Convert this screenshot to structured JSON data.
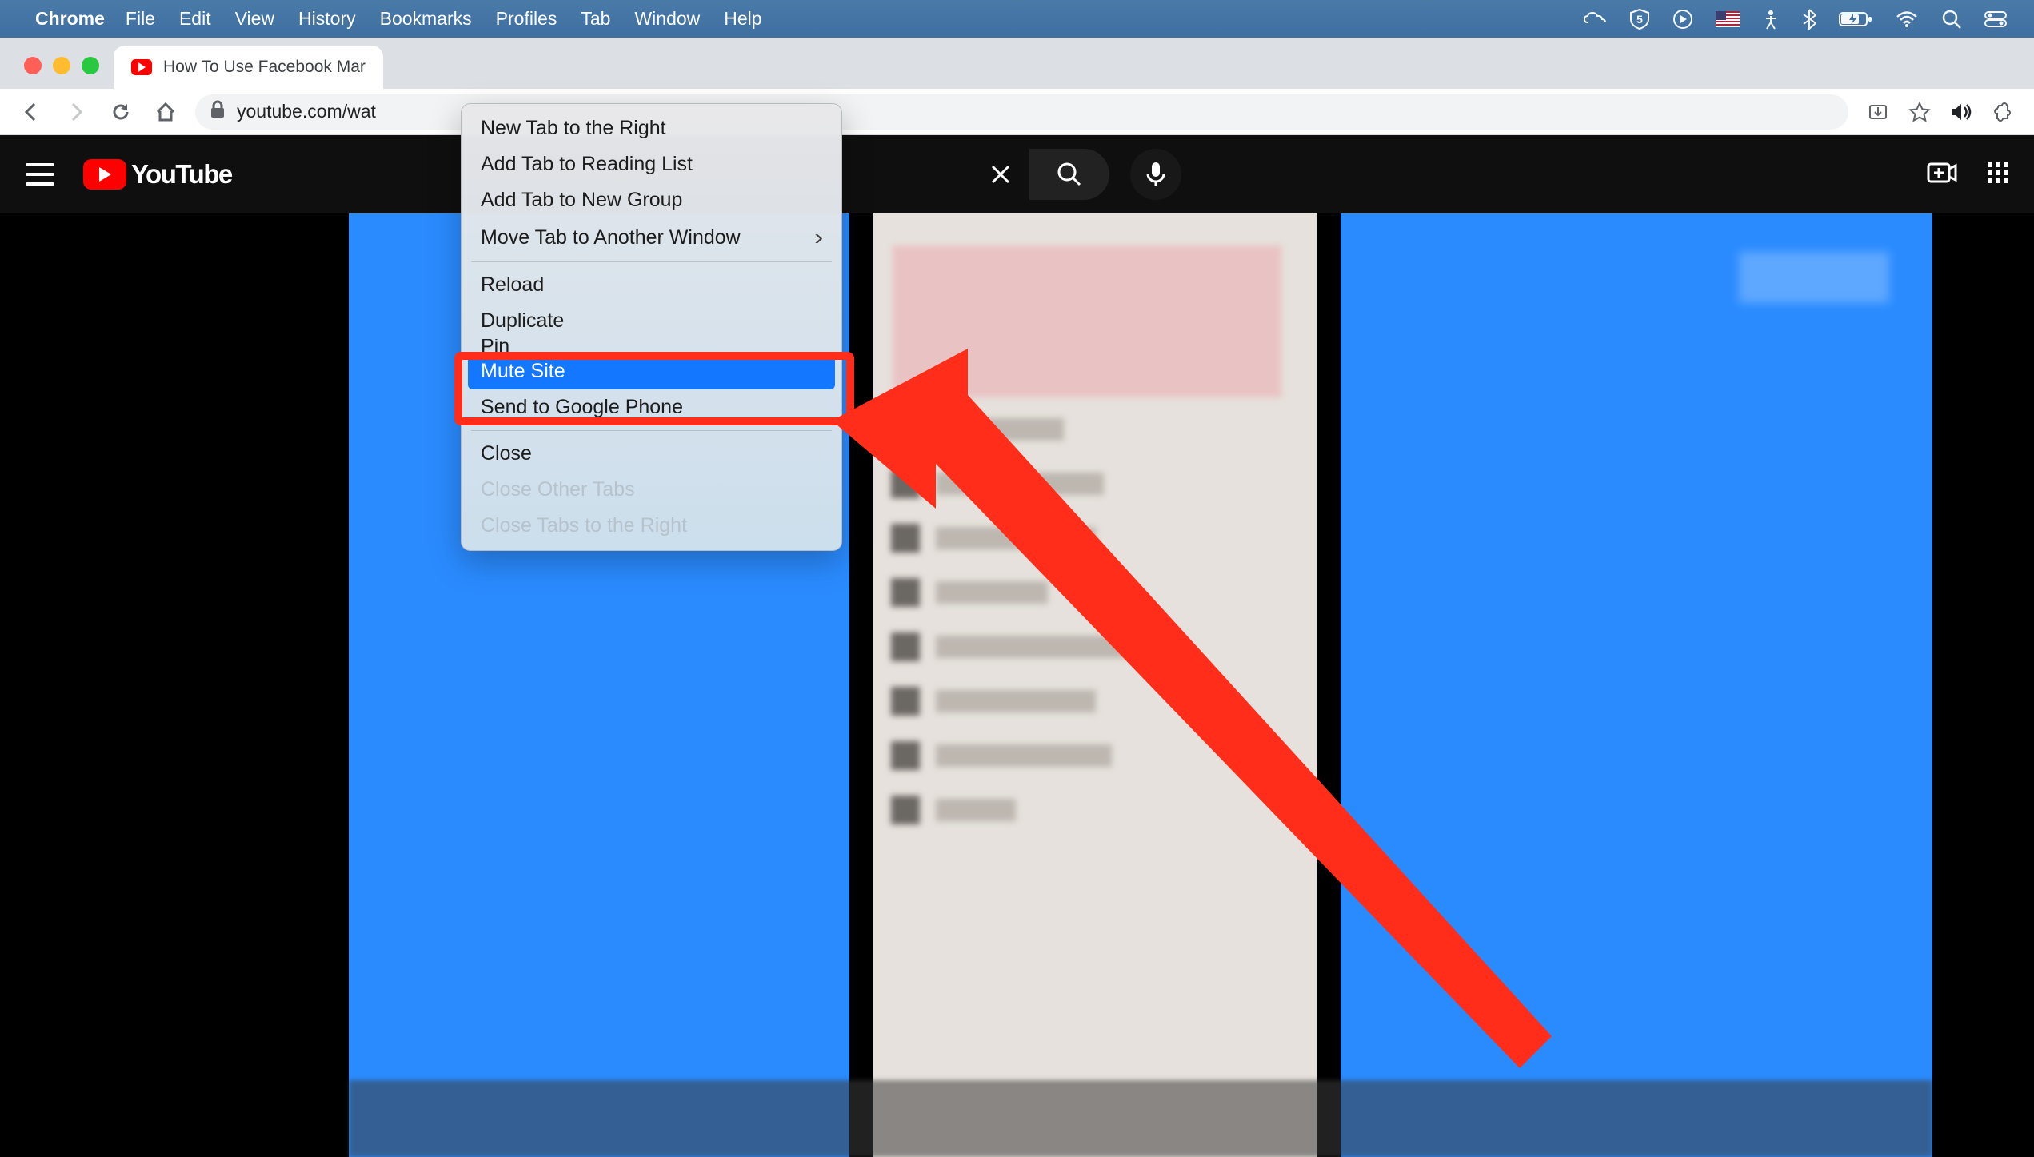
{
  "menubar": {
    "app": "Chrome",
    "items": [
      "File",
      "Edit",
      "View",
      "History",
      "Bookmarks",
      "Profiles",
      "Tab",
      "Window",
      "Help"
    ]
  },
  "tab": {
    "title": "How To Use Facebook Mar"
  },
  "omnibox": {
    "url": "youtube.com/wat"
  },
  "youtube": {
    "logo_text": "YouTube"
  },
  "context_menu": {
    "group1": [
      {
        "label": "New Tab to the Right",
        "enabled": true,
        "submenu": false
      },
      {
        "label": "Add Tab to Reading List",
        "enabled": true,
        "submenu": false
      },
      {
        "label": "Add Tab to New Group",
        "enabled": true,
        "submenu": false
      },
      {
        "label": "Move Tab to Another Window",
        "enabled": true,
        "submenu": true
      }
    ],
    "group2": [
      {
        "label": "Reload",
        "enabled": true,
        "submenu": false
      },
      {
        "label": "Duplicate",
        "enabled": true,
        "submenu": false
      },
      {
        "label": "Pin",
        "enabled": true,
        "submenu": false
      }
    ],
    "highlighted": "Mute Site",
    "group3": [
      {
        "label": "Send to Google Phone",
        "enabled": true,
        "submenu": false
      }
    ],
    "group4": [
      {
        "label": "Close",
        "enabled": true,
        "submenu": false
      },
      {
        "label": "Close Other Tabs",
        "enabled": false,
        "submenu": false
      },
      {
        "label": "Close Tabs to the Right",
        "enabled": false,
        "submenu": false
      }
    ]
  },
  "annotation": {
    "arrow_color": "#ff2d1a"
  }
}
